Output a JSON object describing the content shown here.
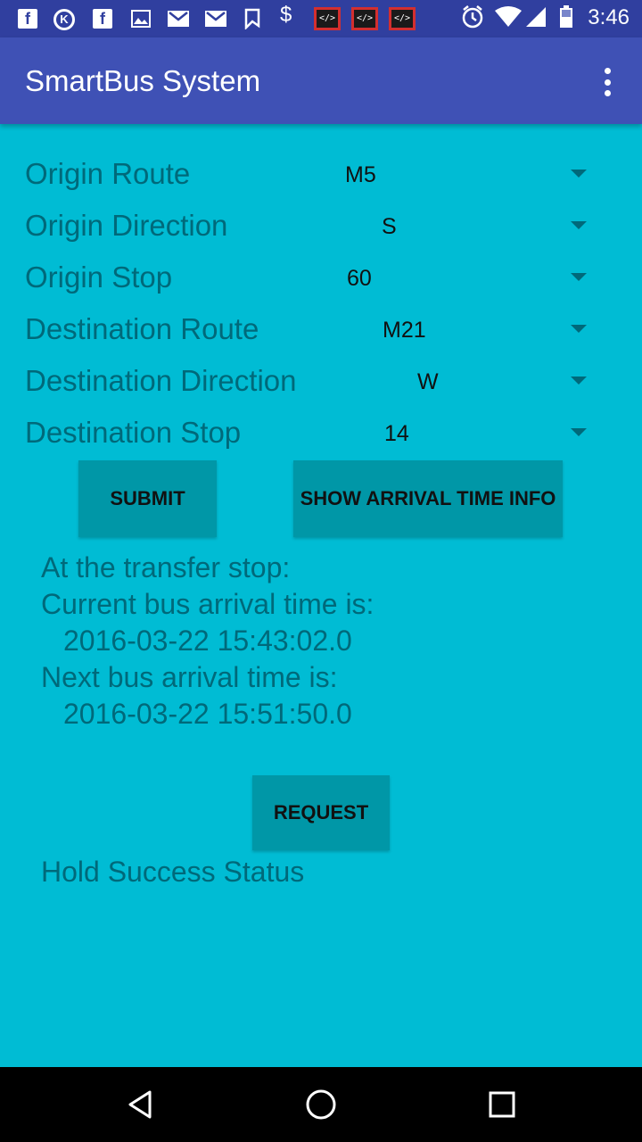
{
  "status_bar": {
    "time": "3:46",
    "icons": [
      "facebook-icon",
      "kik-icon",
      "facebook-icon",
      "image-icon",
      "gmail-icon",
      "gmail-icon",
      "bookmark-icon",
      "dollar-icon",
      "code-icon",
      "code-icon",
      "code-icon",
      "alarm-icon",
      "wifi-icon",
      "signal-icon",
      "battery-icon"
    ],
    "code_label": "</>",
    "dollar": "$",
    "fb": "f",
    "kik": "K"
  },
  "app_bar": {
    "title": "SmartBus System",
    "menu_icon": "overflow-menu-icon"
  },
  "form": {
    "origin_route": {
      "label": "Origin Route",
      "value": "M5"
    },
    "origin_direction": {
      "label": "Origin Direction",
      "value": "S"
    },
    "origin_stop": {
      "label": "Origin Stop",
      "value": "60"
    },
    "destination_route": {
      "label": "Destination Route",
      "value": "M21"
    },
    "destination_direction": {
      "label": "Destination Direction",
      "value": "W"
    },
    "destination_stop": {
      "label": "Destination Stop",
      "value": "14"
    }
  },
  "buttons": {
    "submit": "SUBMIT",
    "show_arrival": "SHOW ARRIVAL TIME INFO",
    "request": "REQUEST"
  },
  "info": {
    "line1": "At the transfer stop:",
    "line2": "Current bus arrival time is:",
    "current_time": "2016-03-22 15:43:02.0",
    "line4": "Next bus arrival time is:",
    "next_time": "2016-03-22 15:51:50.0"
  },
  "hold_status": "Hold Success Status",
  "nav_bar": {
    "back": "back-icon",
    "home": "home-icon",
    "recents": "recents-icon"
  },
  "colors": {
    "status_bar": "#303F9F",
    "app_bar": "#3F51B5",
    "background": "#00BCD4",
    "button": "#0097A7",
    "label_text": "#00697A"
  }
}
